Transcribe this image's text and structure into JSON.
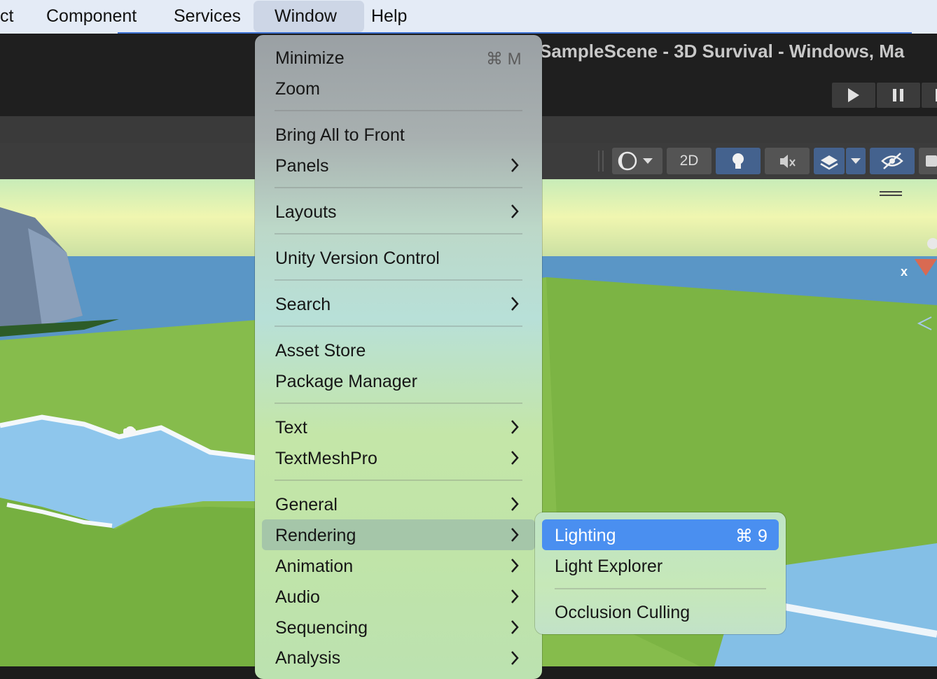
{
  "menubar": {
    "items": [
      {
        "label": "ct"
      },
      {
        "label": "Component"
      },
      {
        "label": "Services"
      },
      {
        "label": "Window"
      },
      {
        "label": "Help"
      }
    ]
  },
  "window": {
    "title": "SampleScene - 3D Survival - Windows, Ma"
  },
  "toolbar": {
    "mode_2d": "2D",
    "accent": "#44628e"
  },
  "window_menu": {
    "minimize": {
      "label": "Minimize",
      "shortcut": "⌘ M"
    },
    "zoom": {
      "label": "Zoom"
    },
    "bring_all": {
      "label": "Bring All to Front"
    },
    "panels": {
      "label": "Panels"
    },
    "layouts": {
      "label": "Layouts"
    },
    "uvc": {
      "label": "Unity Version Control"
    },
    "search": {
      "label": "Search"
    },
    "asset_store": {
      "label": "Asset Store"
    },
    "package_manager": {
      "label": "Package Manager"
    },
    "text": {
      "label": "Text"
    },
    "textmeshpro": {
      "label": "TextMeshPro"
    },
    "general": {
      "label": "General"
    },
    "rendering": {
      "label": "Rendering"
    },
    "animation": {
      "label": "Animation"
    },
    "audio": {
      "label": "Audio"
    },
    "sequencing": {
      "label": "Sequencing"
    },
    "analysis": {
      "label": "Analysis"
    }
  },
  "rendering_submenu": {
    "lighting": {
      "label": "Lighting",
      "shortcut": "⌘ 9"
    },
    "light_explorer": {
      "label": "Light Explorer"
    },
    "occlusion_culling": {
      "label": "Occlusion Culling"
    },
    "highlight": "#4a8ff0"
  },
  "scene": {
    "gizmo_axis": "x"
  }
}
